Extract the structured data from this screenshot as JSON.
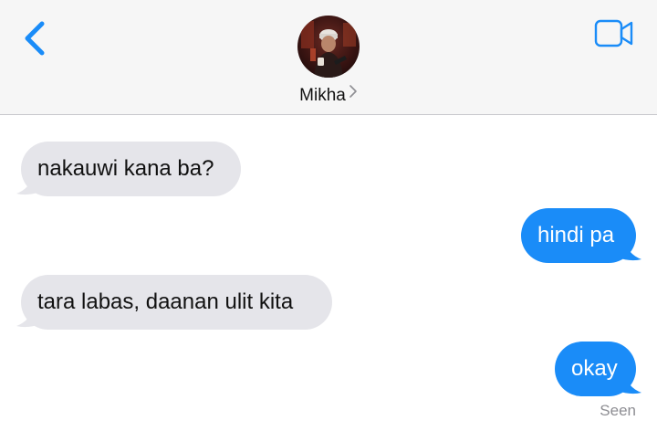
{
  "header": {
    "back_icon": "chevron-left-icon",
    "video_icon": "video-camera-icon",
    "avatar_icon": "contact-avatar-photo",
    "contact_name": "Mikha",
    "accent_color": "#1a8cf8"
  },
  "messages": [
    {
      "direction": "incoming",
      "text": "nakauwi kana ba?"
    },
    {
      "direction": "outgoing",
      "text": "hindi pa"
    },
    {
      "direction": "incoming",
      "text": "tara labas, daanan ulit kita"
    },
    {
      "direction": "outgoing",
      "text": "okay"
    }
  ],
  "status": {
    "read_receipt": "Seen"
  },
  "colors": {
    "incoming_bubble": "#e5e5ea",
    "outgoing_bubble": "#1a8cf8",
    "header_background": "#f6f6f6"
  }
}
